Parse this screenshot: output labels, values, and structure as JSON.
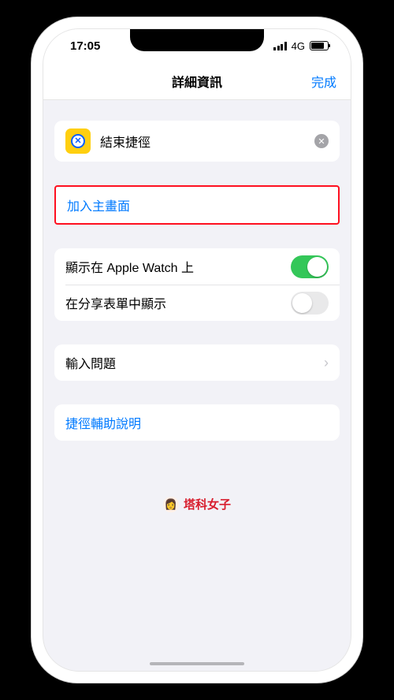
{
  "status": {
    "time": "17:05",
    "network_label": "4G"
  },
  "nav": {
    "title": "詳細資訊",
    "done": "完成"
  },
  "shortcut": {
    "name": "結束捷徑"
  },
  "actions": {
    "add_to_home": "加入主畫面"
  },
  "options": {
    "show_on_apple_watch": {
      "label": "顯示在 Apple Watch 上",
      "on": true
    },
    "show_in_share_sheet": {
      "label": "在分享表單中顯示",
      "on": false
    }
  },
  "import": {
    "label": "輸入問題"
  },
  "help": {
    "label": "捷徑輔助說明"
  },
  "brand": {
    "name": "塔科女子",
    "emoji": "👩"
  }
}
